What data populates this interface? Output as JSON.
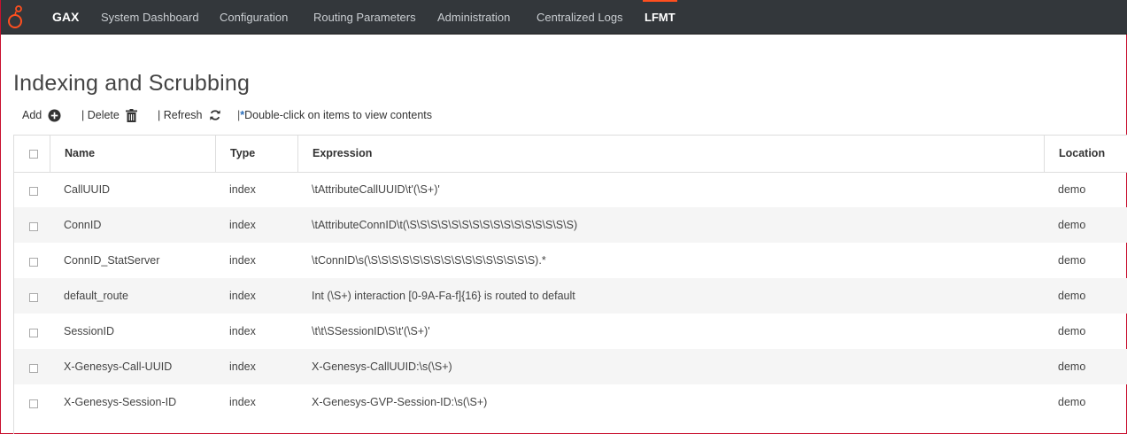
{
  "nav": {
    "brand": "GAX",
    "items": [
      {
        "label": "System Dashboard"
      },
      {
        "label": "Configuration"
      },
      {
        "label": "Routing Parameters"
      },
      {
        "label": "Administration"
      },
      {
        "label": "Centralized Logs"
      },
      {
        "label": "LFMT",
        "active": true
      }
    ],
    "accent_color": "#ff4f1f"
  },
  "page": {
    "title": "Indexing and Scrubbing"
  },
  "toolbar": {
    "add_label": "Add",
    "add_icon": "plus-circle-icon",
    "delete_label": "| Delete",
    "delete_icon": "trash-icon",
    "refresh_label": "| Refresh",
    "refresh_icon": "refresh-icon",
    "hint_prefix": "|",
    "hint_star": "*",
    "hint_text": "Double-click on items to view contents"
  },
  "table": {
    "columns": [
      "Name",
      "Type",
      "Expression",
      "Location"
    ],
    "rows": [
      {
        "name": "CallUUID",
        "type": "index",
        "expression": "\\tAttributeCallUUID\\t'(\\S+)'",
        "location": "demo"
      },
      {
        "name": "ConnID",
        "type": "index",
        "expression": "\\tAttributeConnID\\t(\\S\\S\\S\\S\\S\\S\\S\\S\\S\\S\\S\\S\\S\\S\\S\\S)",
        "location": "demo"
      },
      {
        "name": "ConnID_StatServer",
        "type": "index",
        "expression": "\\tConnID\\s(\\S\\S\\S\\S\\S\\S\\S\\S\\S\\S\\S\\S\\S\\S\\S\\S).*",
        "location": "demo"
      },
      {
        "name": "default_route",
        "type": "index",
        "expression": "Int (\\S+) interaction [0-9A-Fa-f]{16} is routed to default",
        "location": "demo"
      },
      {
        "name": "SessionID",
        "type": "index",
        "expression": "\\t\\t\\SSessionID\\S\\t'(\\S+)'",
        "location": "demo"
      },
      {
        "name": "X-Genesys-Call-UUID",
        "type": "index",
        "expression": "X-Genesys-CallUUID:\\s(\\S+)",
        "location": "demo"
      },
      {
        "name": "X-Genesys-Session-ID",
        "type": "index",
        "expression": "X-Genesys-GVP-Session-ID:\\s(\\S+)",
        "location": "demo"
      }
    ]
  }
}
